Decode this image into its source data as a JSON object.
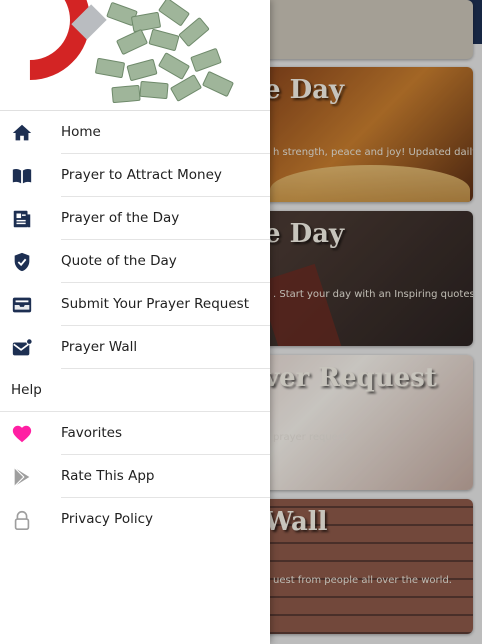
{
  "background": {
    "cards": [
      {
        "title": "e Day",
        "description": "h strength, peace and joy! Updated daily"
      },
      {
        "title": "e Day",
        "description": ". Start your day with an Inspiring quotes!"
      },
      {
        "title": "ver Request",
        "description": "prayer request"
      },
      {
        "title": "Wall",
        "description": "uest from people all over the world."
      }
    ]
  },
  "drawer": {
    "items": [
      {
        "label": "Home",
        "icon": "home-icon"
      },
      {
        "label": "Prayer to Attract Money",
        "icon": "book-icon"
      },
      {
        "label": "Prayer of the Day",
        "icon": "document-icon"
      },
      {
        "label": "Quote of the Day",
        "icon": "shield-check-icon"
      },
      {
        "label": "Submit Your Prayer Request",
        "icon": "inbox-icon"
      },
      {
        "label": "Prayer Wall",
        "icon": "mail-notification-icon"
      }
    ],
    "section_label": "Help",
    "help_items": [
      {
        "label": "Favorites",
        "icon": "heart-icon"
      },
      {
        "label": "Rate This App",
        "icon": "play-store-icon"
      },
      {
        "label": "Privacy Policy",
        "icon": "lock-icon"
      }
    ]
  },
  "colors": {
    "appbar": "#1d2f52",
    "icon": "#1d2f52",
    "heart": "#ff1fa3",
    "muted_icon": "#9e9e9e"
  }
}
